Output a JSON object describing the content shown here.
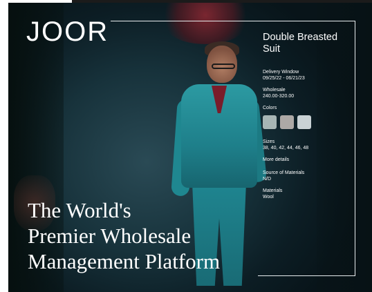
{
  "brand": {
    "logo_text": "JOOR"
  },
  "product": {
    "title_line1": "Double Breasted",
    "title_line2": "Suit",
    "specs": {
      "delivery_window": {
        "label": "Delivery Window",
        "value": "09/25/22 - 06/21/23"
      },
      "wholesale": {
        "label": "Wholesale",
        "value": "240.00-320.00"
      },
      "colors": {
        "label": "Colors",
        "swatches": [
          {
            "name": "sage-grey",
            "hex": "#a7b6b5"
          },
          {
            "name": "warm-grey",
            "hex": "#ada9a6"
          },
          {
            "name": "pale-blue-grey",
            "hex": "#c9d2d5"
          }
        ]
      },
      "sizes": {
        "label": "Sizes",
        "value": "38, 40, 42, 44, 46, 48"
      },
      "more_details_label": "More details",
      "source_of_materials": {
        "label": "Source of Materials",
        "value": "N/D"
      },
      "materials": {
        "label": "Materials",
        "value": "Wool"
      }
    }
  },
  "tagline": {
    "line1": "The World's",
    "line2": "Premier Wholesale",
    "line3": "Management Platform"
  },
  "colors": {
    "frame_line": "#e9eef0",
    "suit_teal": "#1f8590",
    "background_dark": "#0c1d24"
  }
}
